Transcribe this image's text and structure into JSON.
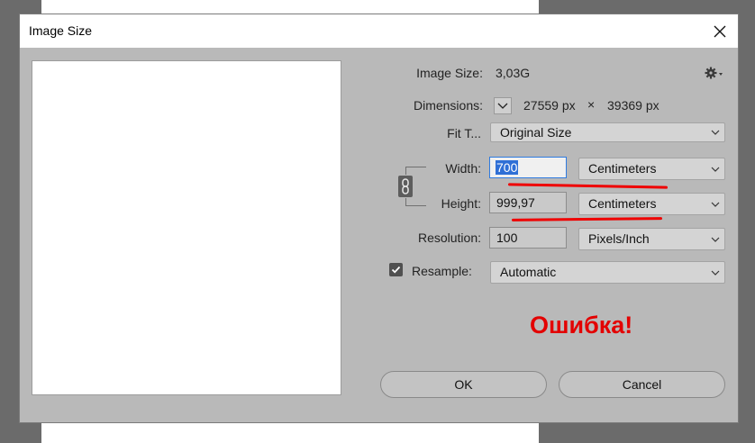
{
  "dialog": {
    "title": "Image Size"
  },
  "info": {
    "image_size_label": "Image Size:",
    "image_size_value": "3,03G",
    "dimensions_label": "Dimensions:",
    "dim_width": "27559 px",
    "dim_times": "×",
    "dim_height": "39369 px"
  },
  "fit_to": {
    "label": "Fit T...",
    "value": "Original Size"
  },
  "width": {
    "label": "Width:",
    "value": "700",
    "unit": "Centimeters"
  },
  "height": {
    "label": "Height:",
    "value": "999,97",
    "unit": "Centimeters"
  },
  "resolution": {
    "label": "Resolution:",
    "value": "100",
    "unit": "Pixels/Inch"
  },
  "resample": {
    "label": "Resample:",
    "checked": true,
    "value": "Automatic"
  },
  "annotation": {
    "error_text": "Ошибка!",
    "underline_color": "#ef0000"
  },
  "buttons": {
    "ok": "OK",
    "cancel": "Cancel"
  },
  "icons": {
    "close": "close-icon",
    "gear": "gear-icon",
    "chain": "chain-link-icon",
    "dimensions_dropdown": "chevron-down-icon",
    "checkbox": "checkmark-icon"
  }
}
